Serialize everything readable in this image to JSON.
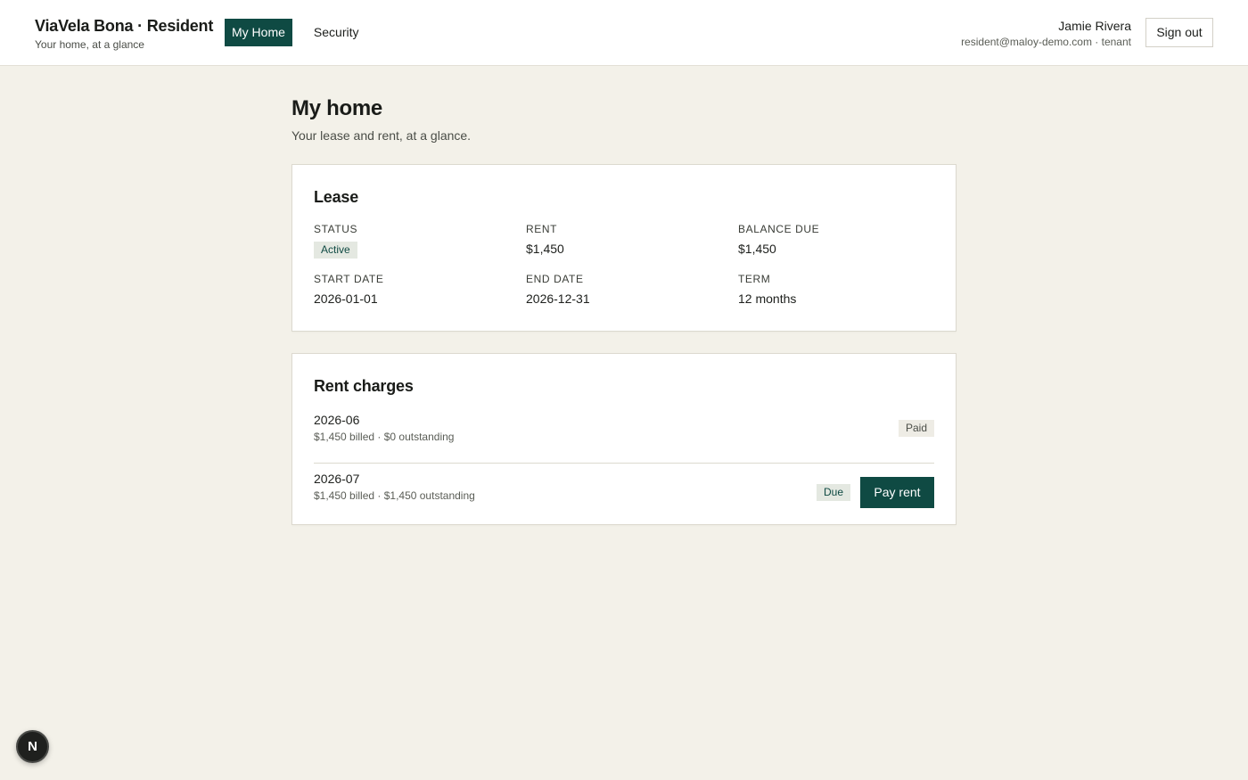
{
  "header": {
    "brand_title": "ViaVela Bona · Resident",
    "brand_subtitle": "Your home, at a glance",
    "nav": [
      {
        "label": "My Home",
        "active": true
      },
      {
        "label": "Security",
        "active": false
      }
    ],
    "user_name": "Jamie Rivera",
    "user_email": "resident@maloy-demo.com · tenant",
    "sign_out_label": "Sign out"
  },
  "page": {
    "title": "My home",
    "subtitle": "Your lease and rent, at a glance."
  },
  "lease": {
    "title": "Lease",
    "status_label": "Status",
    "status_value": "Active",
    "rent_label": "Rent",
    "rent_value": "$1,450",
    "balance_label": "Balance due",
    "balance_value": "$1,450",
    "start_label": "Start date",
    "start_value": "2026-01-01",
    "end_label": "End date",
    "end_value": "2026-12-31",
    "term_label": "Term",
    "term_value": "12 months"
  },
  "charges": {
    "title": "Rent charges",
    "items": [
      {
        "period": "2026-06",
        "meta": "$1,450 billed · $0 outstanding",
        "status": "Paid"
      },
      {
        "period": "2026-07",
        "meta": "$1,450 billed · $1,450 outstanding",
        "status": "Due",
        "action": "Pay rent"
      }
    ]
  },
  "corner_badge": {
    "letter": "N",
    "icon": "n-logo-icon"
  },
  "colors": {
    "accent": "#0f4a43",
    "background": "#f3f1e9",
    "card": "#ffffff"
  }
}
